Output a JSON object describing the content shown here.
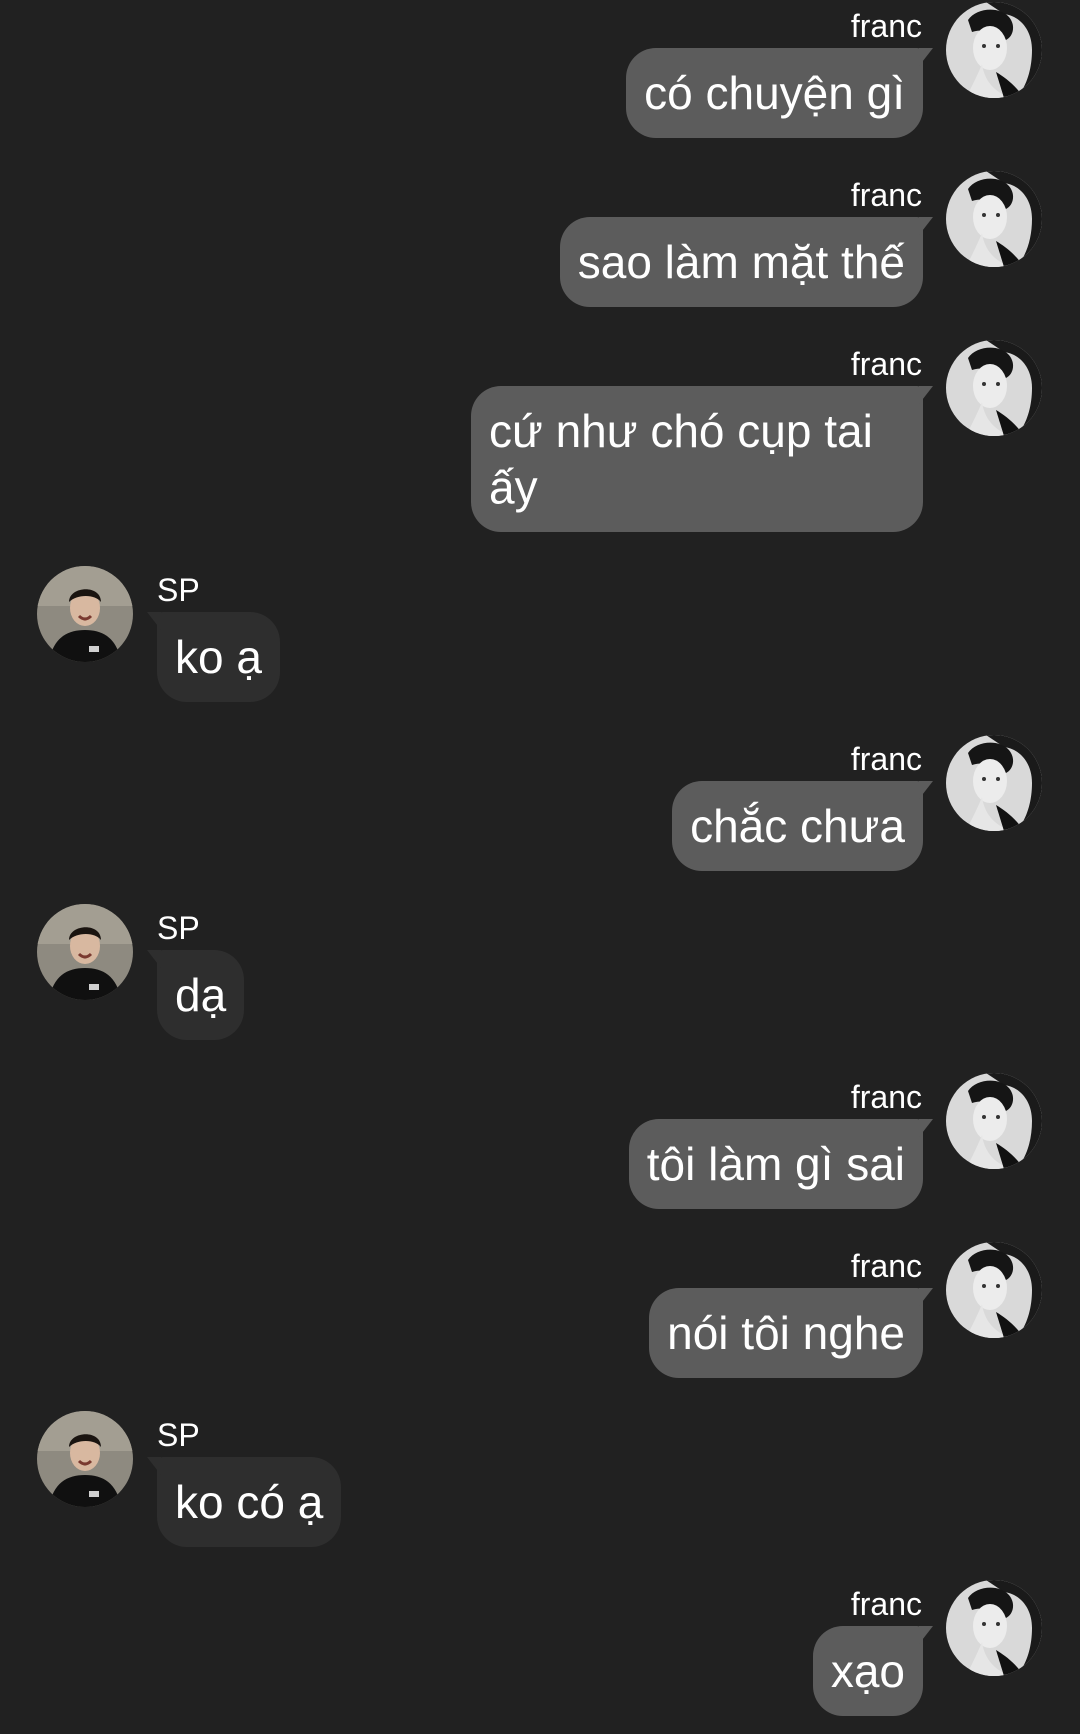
{
  "messages": [
    {
      "side": "out",
      "sender": "franc",
      "text": "có chuyện gì"
    },
    {
      "side": "out",
      "sender": "franc",
      "text": "sao làm mặt thế"
    },
    {
      "side": "out",
      "sender": "franc",
      "text": "cứ như chó cụp tai ấy"
    },
    {
      "side": "in",
      "sender": "SP",
      "text": "ko ạ"
    },
    {
      "side": "out",
      "sender": "franc",
      "text": "chắc chưa"
    },
    {
      "side": "in",
      "sender": "SP",
      "text": "dạ"
    },
    {
      "side": "out",
      "sender": "franc",
      "text": "tôi làm gì sai"
    },
    {
      "side": "out",
      "sender": "franc",
      "text": "nói tôi nghe"
    },
    {
      "side": "in",
      "sender": "SP",
      "text": "ko có ạ"
    },
    {
      "side": "out",
      "sender": "franc",
      "text": "xạo"
    }
  ],
  "icons": {
    "franc_avatar": "franc-avatar-icon",
    "sp_avatar": "sp-avatar-icon"
  },
  "colors": {
    "background": "#212121",
    "outgoing_bubble": "#5c5c5c",
    "incoming_bubble": "#2e2e2e",
    "text": "#ffffff"
  }
}
